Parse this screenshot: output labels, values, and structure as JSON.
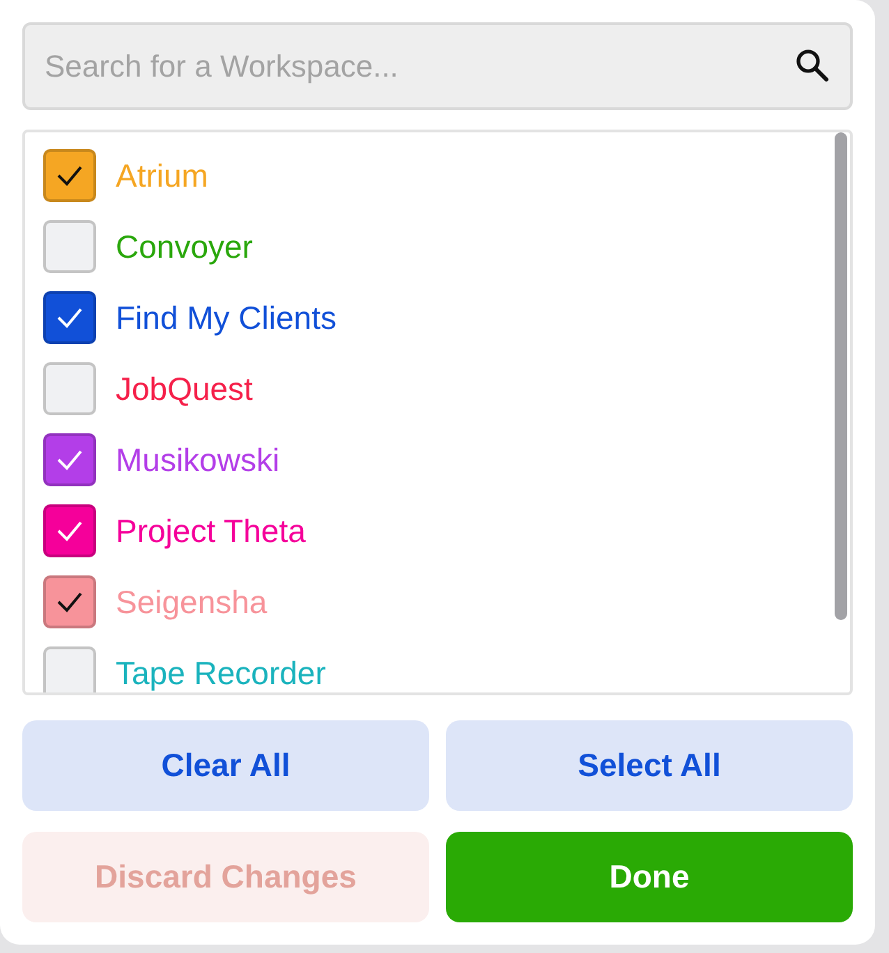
{
  "search": {
    "placeholder": "Search for a Workspace..."
  },
  "workspaces": [
    {
      "name": "Atrium",
      "checked": true,
      "color": "#f5a623"
    },
    {
      "name": "Convoyer",
      "checked": false,
      "color": "#2aa70c"
    },
    {
      "name": "Find My Clients",
      "checked": true,
      "color": "#1150d8"
    },
    {
      "name": "JobQuest",
      "checked": false,
      "color": "#f5204a"
    },
    {
      "name": "Musikowski",
      "checked": true,
      "color": "#b33ee8"
    },
    {
      "name": "Project Theta",
      "checked": true,
      "color": "#f5009a"
    },
    {
      "name": "Seigensha",
      "checked": true,
      "color": "#f7939a"
    },
    {
      "name": "Tape Recorder",
      "checked": false,
      "color": "#1ab3bd"
    }
  ],
  "buttons": [
    {
      "label": "Clear All",
      "kind": "secondary",
      "disabled": false
    },
    {
      "label": "Select All",
      "kind": "secondary",
      "disabled": false
    },
    {
      "label": "Discard Changes",
      "kind": "danger",
      "disabled": true
    },
    {
      "label": "Done",
      "kind": "primary",
      "disabled": false
    }
  ]
}
